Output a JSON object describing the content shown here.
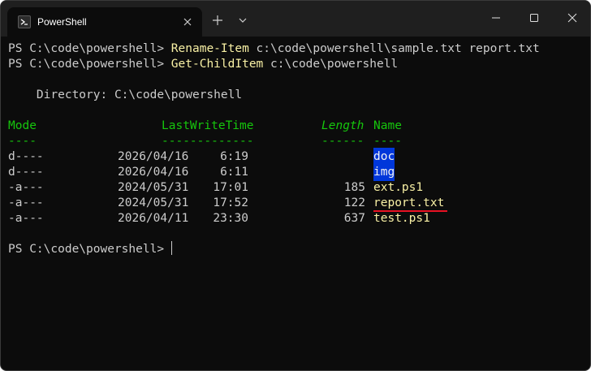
{
  "window": {
    "tab_title": "PowerShell",
    "icons": {
      "tab_icon": "powershell-icon",
      "close_tab": "close-icon",
      "new_tab": "plus-icon",
      "dropdown": "chevron-down-icon",
      "minimize": "minimize-icon",
      "maximize": "maximize-icon",
      "close_window": "close-icon"
    }
  },
  "terminal": {
    "prompt": "PS C:\\code\\powershell> ",
    "commands": [
      {
        "name": "Rename-Item",
        "args": " c:\\code\\powershell\\sample.txt report.txt"
      },
      {
        "name": "Get-ChildItem",
        "args": " c:\\code\\powershell"
      }
    ],
    "directory_label": "    Directory: C:\\code\\powershell",
    "headers": {
      "mode": "Mode",
      "lastwritetime": "LastWriteTime",
      "length": "Length",
      "name": "Name"
    },
    "separators": {
      "mode": "----",
      "lastwritetime": "-------------",
      "length": "------",
      "name": "----"
    },
    "rows": [
      {
        "mode": "d----",
        "date": "2026/04/16",
        "time": "6:19",
        "length": "",
        "name": "doc",
        "is_dir": true
      },
      {
        "mode": "d----",
        "date": "2026/04/16",
        "time": "6:11",
        "length": "",
        "name": "img",
        "is_dir": true
      },
      {
        "mode": "-a---",
        "date": "2024/05/31",
        "time": "17:01",
        "length": "185",
        "name": "ext.ps1",
        "is_dir": false
      },
      {
        "mode": "-a---",
        "date": "2024/05/31",
        "time": "17:52",
        "length": "122",
        "name": "report.txt",
        "is_dir": false,
        "underlined": true
      },
      {
        "mode": "-a---",
        "date": "2026/04/11",
        "time": "23:30",
        "length": "637",
        "name": "test.ps1",
        "is_dir": false
      }
    ],
    "final_prompt": "PS C:\\code\\powershell> "
  },
  "colors": {
    "background": "#0c0c0c",
    "titlebar": "#1f1f1f",
    "text": "#cccccc",
    "command": "#f9f1a5",
    "header": "#16c60c",
    "dir_highlight": "#0037da",
    "underline": "#e81123"
  }
}
